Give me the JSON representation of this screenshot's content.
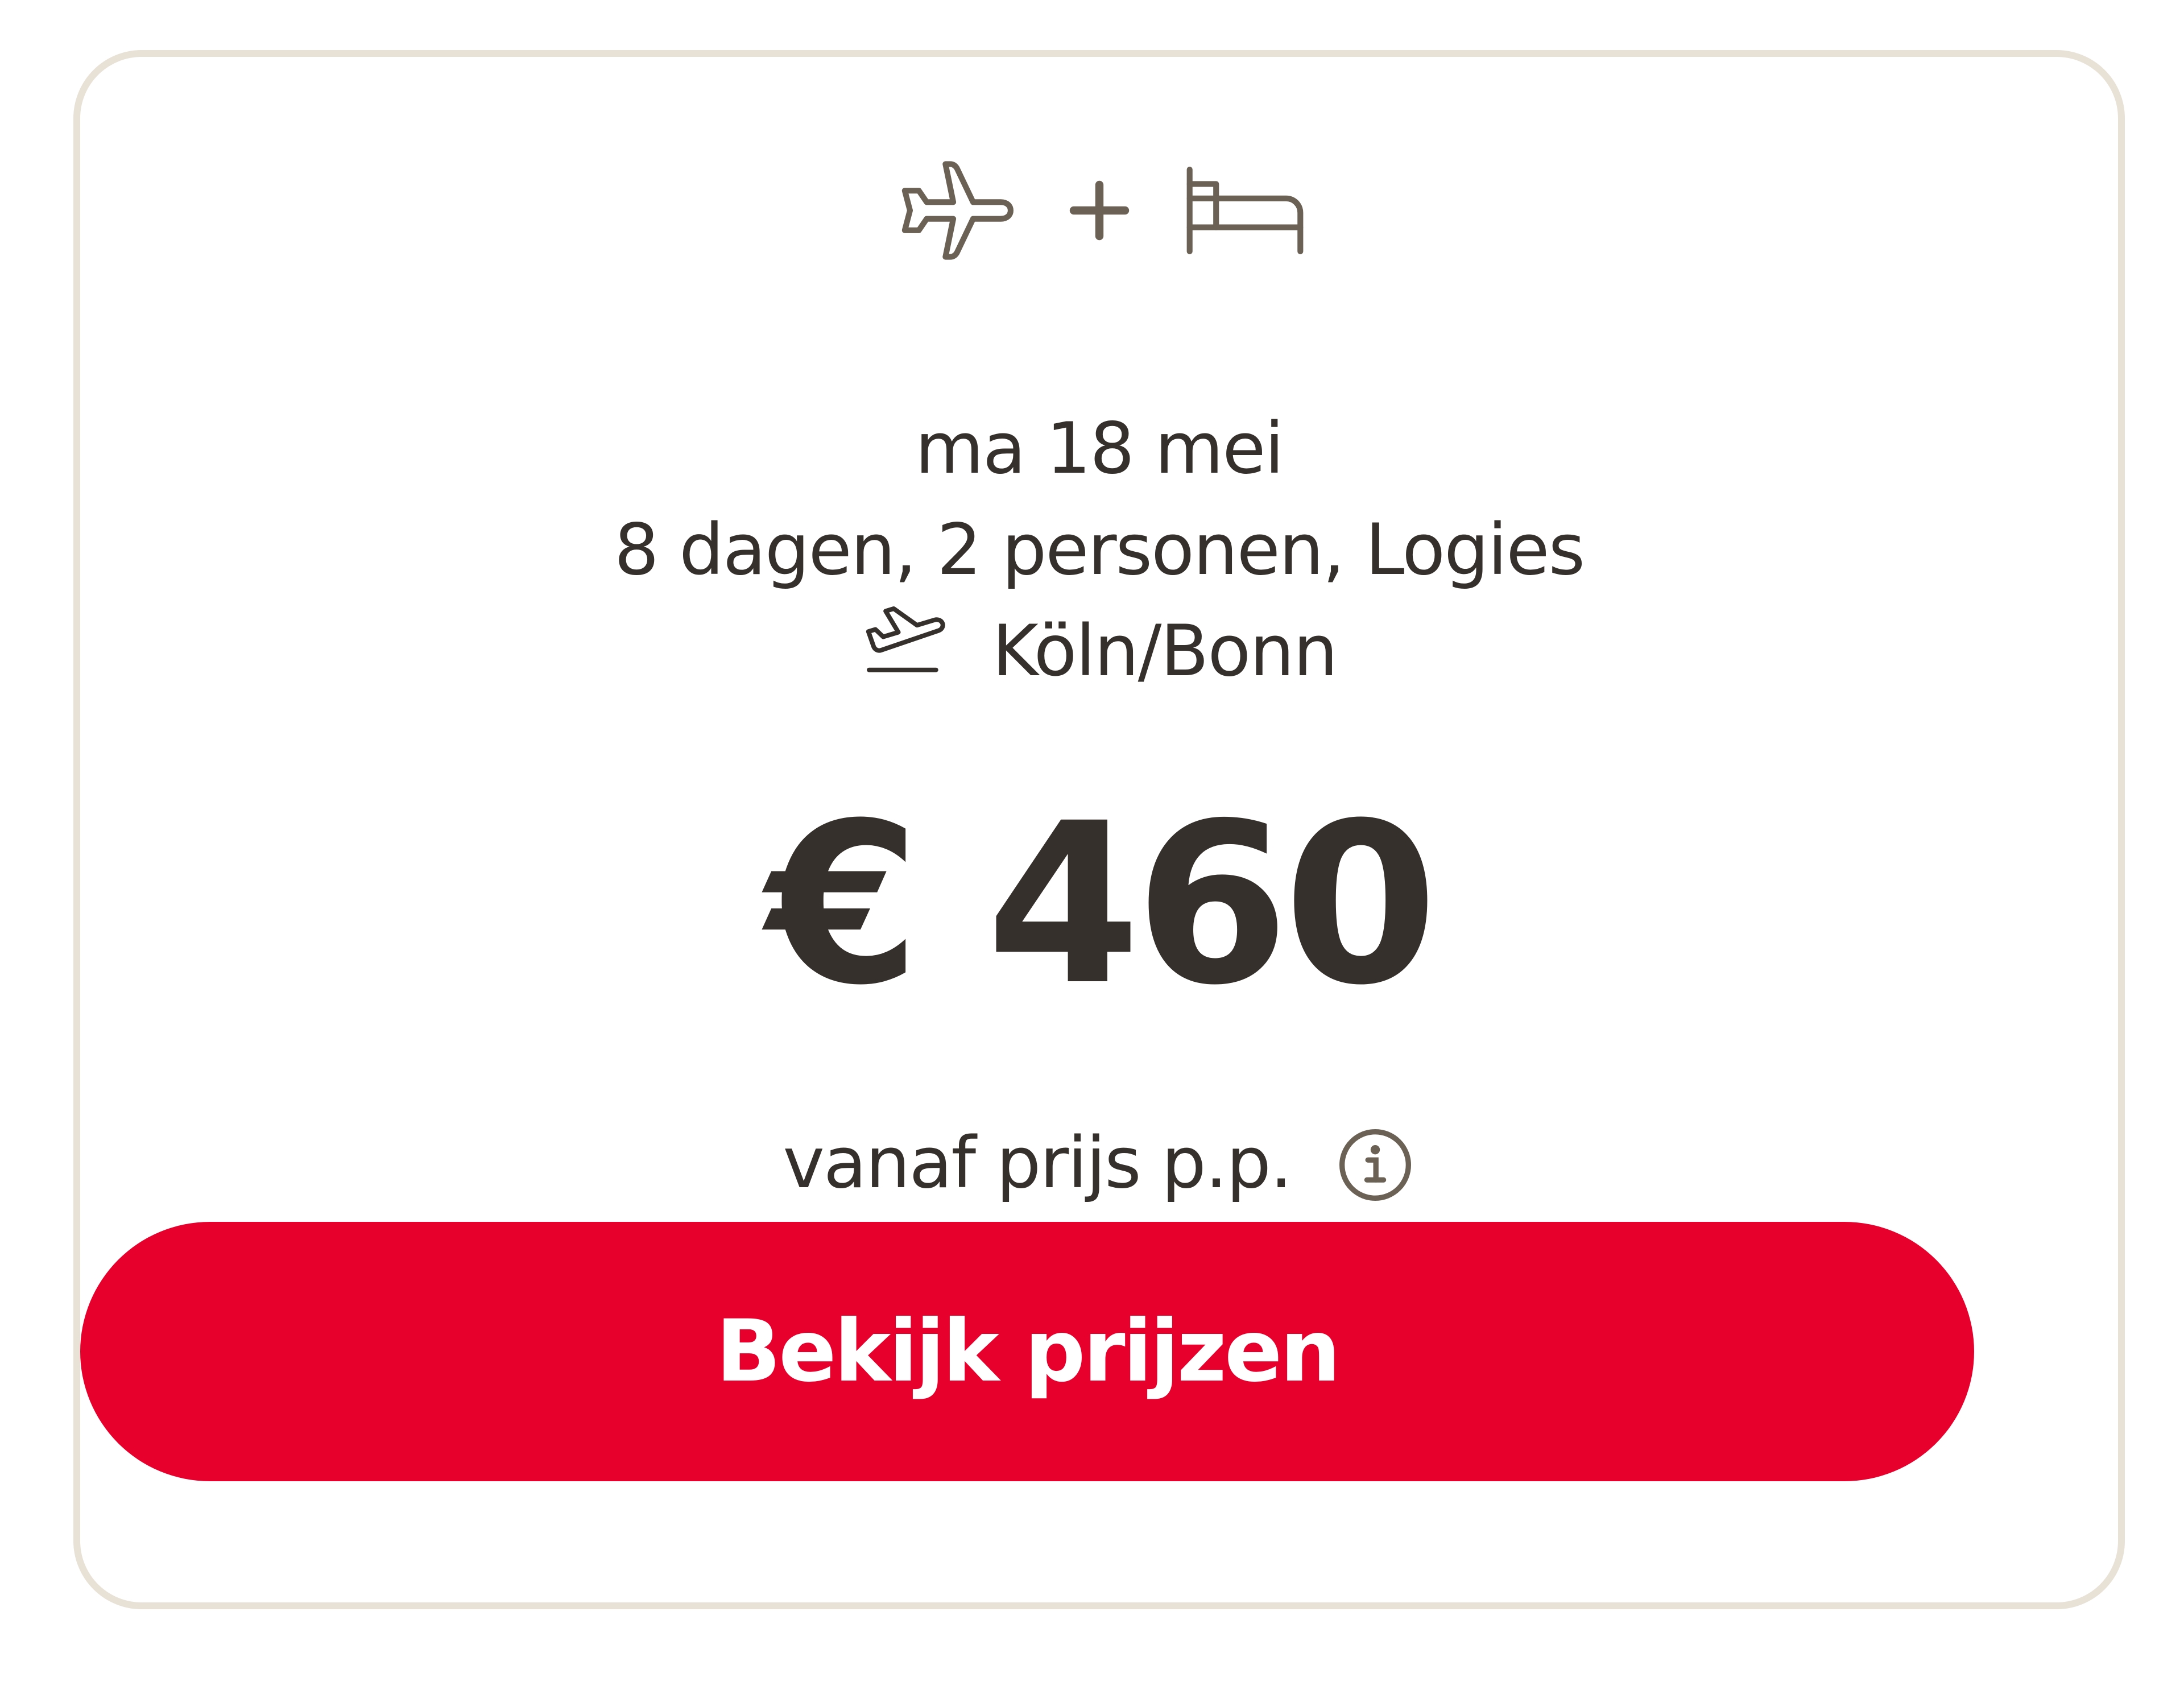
{
  "card": {
    "icons": {
      "left": "plane-icon",
      "plus": "plus-icon",
      "right": "bed-icon"
    },
    "date": "ma 18 mei",
    "details": "8 dagen, 2 personen, Logies",
    "departure_icon": "departure-plane-icon",
    "departure_airport": "Köln/Bonn",
    "price": "€ 460",
    "price_note": "vanaf prijs p.p.",
    "info_icon": "info-icon",
    "cta_label": "Bekijk prijzen"
  },
  "colors": {
    "text": "#35302b",
    "icon": "#6b6154",
    "border": "#e8e1d6",
    "cta_background": "#e8002d",
    "cta_text": "#ffffff"
  }
}
